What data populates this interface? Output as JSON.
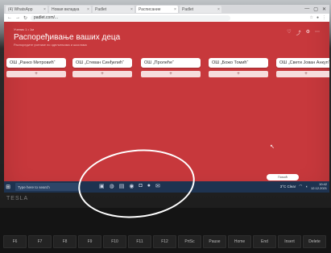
{
  "browser": {
    "tabs": [
      {
        "label": "(4) WhatsApp"
      },
      {
        "label": "Новая вкладка"
      },
      {
        "label": "Padlet"
      },
      {
        "label": "Расписание"
      },
      {
        "label": "Padlet"
      }
    ],
    "url": "padlet.com/...",
    "controls": {
      "minimize": "—",
      "maximize": "▢",
      "close": "✕"
    }
  },
  "padlet": {
    "author": "Ученик 1 • 1м",
    "title": "Распоређивање ваших деца",
    "subtitle": "Распоредите ученике по одељењима и школама",
    "header_icons": [
      "heart-icon",
      "share-icon",
      "gear-icon",
      "more-icon"
    ],
    "columns": [
      {
        "title": "ОШ „Ранко Митровић“",
        "add": "+"
      },
      {
        "title": "ОШ „Стеван Синђелић“",
        "add": "+"
      },
      {
        "title": "ОШ „Пролеће“",
        "add": "+"
      },
      {
        "title": "ОШ „Божо Томић“",
        "add": "+"
      },
      {
        "title": "ОШ „Свети Јован Анкуп“",
        "add": "+"
      }
    ],
    "help": "Помоћ"
  },
  "taskbar": {
    "start": "⊞",
    "search_placeholder": "Type here to search",
    "apps": [
      "▣",
      "◍",
      "▤",
      "◉",
      "◘",
      "●",
      "✉"
    ],
    "weather": "3°C Clear",
    "time": "10:42",
    "date": "12.12.2021"
  },
  "laptop": {
    "brand": "TESLA",
    "keys": [
      "F6",
      "F7",
      "F8",
      "F9",
      "F10",
      "F11",
      "F12",
      "PrtSc",
      "Pause",
      "Home",
      "End",
      "Insert",
      "Delete"
    ]
  },
  "colors": {
    "board": "#c7383c",
    "taskbar": "#1e3350",
    "annotation": "#ffffff"
  }
}
